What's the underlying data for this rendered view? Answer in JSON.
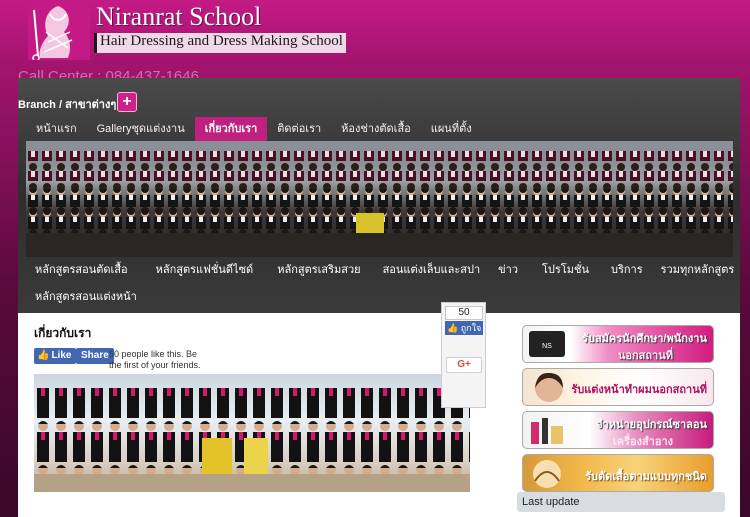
{
  "header": {
    "school_name": "Niranrat School",
    "tagline": "Hair Dressing and Dress Making School",
    "call_center": "Call Center : 084-437-1646"
  },
  "branch": {
    "label": "Branch / สาขาต่างๆ",
    "plus_symbol": "+"
  },
  "top_nav": [
    {
      "label": "หน้าแรก",
      "active": false
    },
    {
      "label": "Galleryชุดแต่งงาน",
      "active": false
    },
    {
      "label": "เกี่ยวกับเรา",
      "active": true
    },
    {
      "label": "ติดต่อเรา",
      "active": false
    },
    {
      "label": "ห้องช่างตัดเสื้อ",
      "active": false
    },
    {
      "label": "แผนที่ตั้ง",
      "active": false
    }
  ],
  "sub_nav_row1": [
    "หลักสูตรสอนตัดเสื้อ",
    "หลักสูตรแฟชั่นดีไซด์",
    "หลักสูตรเสริมสวย",
    "สอนแต่งเล็บและสปา",
    "ข่าว",
    "โปรโมชั่น",
    "บริการ",
    "รวมทุกหลักสูตร"
  ],
  "sub_nav_row2": [
    "หลักสูตรสอนแต่งหน้า"
  ],
  "content": {
    "title": "เกี่ยวกับเรา",
    "fb_like": "Like",
    "fb_share": "Share",
    "fb_text": "50 people like this. Be the first of your friends."
  },
  "share_box": {
    "count": "50",
    "like_label": "ถูกใจ",
    "gplus_label": "G+"
  },
  "ads": [
    {
      "line1": "รับสมัครนักศึกษา/พนักงาน",
      "line2": "นอกสถานที่"
    },
    {
      "line1": "รับแต่งหน้าทำผมนอกสถานที่"
    },
    {
      "line1": "จำหน่ายอุปกรณ์ซาลอน",
      "line2": "เครื่องสำอาง"
    },
    {
      "line1": "รับตัดเสื้อตามแบบทุกชนิด"
    }
  ],
  "sidebar": {
    "last_update": "Last update"
  },
  "colors": {
    "brand_pink": "#c0207f",
    "nav_dark": "#2e2e2e",
    "facebook_blue": "#4267b2"
  }
}
